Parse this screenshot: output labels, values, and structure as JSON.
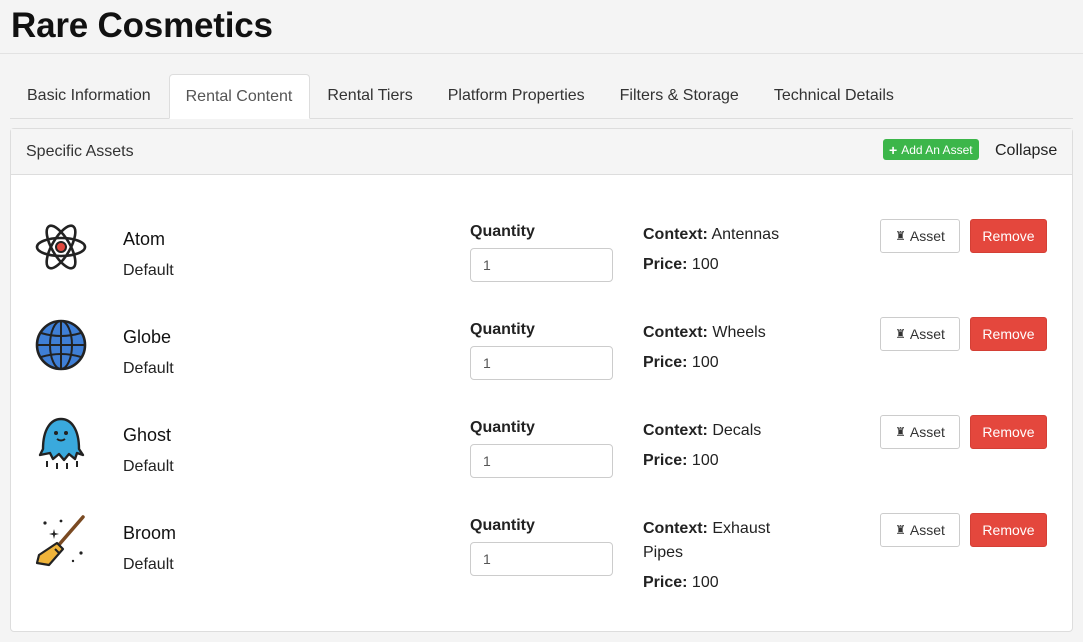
{
  "page": {
    "title": "Rare Cosmetics"
  },
  "tabs": [
    {
      "label": "Basic Information",
      "active": false
    },
    {
      "label": "Rental Content",
      "active": true
    },
    {
      "label": "Rental Tiers",
      "active": false
    },
    {
      "label": "Platform Properties",
      "active": false
    },
    {
      "label": "Filters & Storage",
      "active": false
    },
    {
      "label": "Technical Details",
      "active": false
    }
  ],
  "panel": {
    "title": "Specific Assets",
    "add_label": "Add An Asset",
    "collapse_label": "Collapse"
  },
  "labels": {
    "quantity": "Quantity",
    "context": "Context:",
    "price": "Price:",
    "asset_button": "Asset",
    "remove_button": "Remove"
  },
  "assets": [
    {
      "name": "Atom",
      "variant": "Default",
      "quantity": "1",
      "context": "Antennas",
      "price": "100",
      "icon": "atom-icon"
    },
    {
      "name": "Globe",
      "variant": "Default",
      "quantity": "1",
      "context": "Wheels",
      "price": "100",
      "icon": "globe-icon"
    },
    {
      "name": "Ghost",
      "variant": "Default",
      "quantity": "1",
      "context": "Decals",
      "price": "100",
      "icon": "ghost-icon"
    },
    {
      "name": "Broom",
      "variant": "Default",
      "quantity": "1",
      "context": "Exhaust Pipes",
      "price": "100",
      "icon": "broom-icon"
    }
  ],
  "colors": {
    "add_button": "#3cb64a",
    "remove_button": "#e4473d",
    "globe": "#3f7fd6",
    "ghost": "#3aa9dd",
    "atom_nucleus": "#e0493f",
    "broom_bristles": "#f0b43a"
  }
}
